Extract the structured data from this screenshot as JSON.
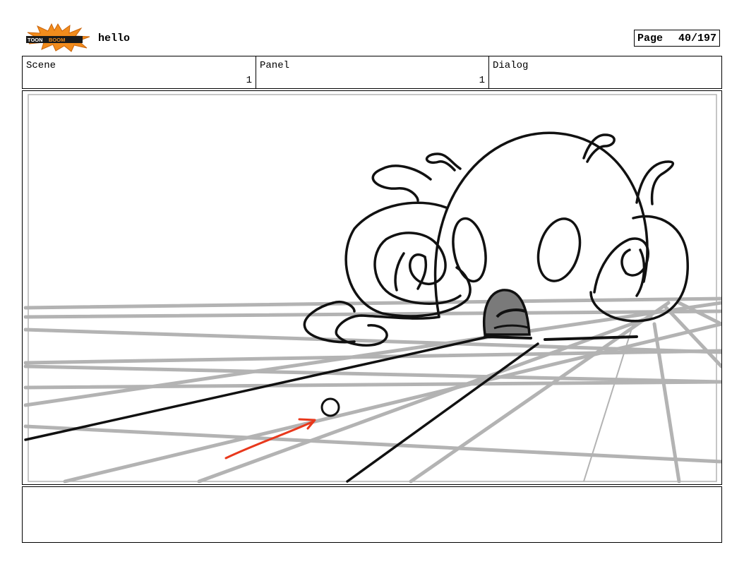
{
  "header": {
    "logo_text_left": "TOON",
    "logo_text_right": "BOOM",
    "project_title": "hello",
    "page_label": "Page",
    "page_number": "40/197"
  },
  "info": {
    "scene_label": "Scene",
    "scene_value": "1",
    "panel_label": "Panel",
    "panel_value": "1",
    "dialog_label": "Dialog",
    "dialog_value": ""
  },
  "notes": {
    "text": ""
  },
  "colors": {
    "grid": "#b3b3b3",
    "ink": "#111111",
    "arrow": "#e8381c",
    "shadow": "#7a7a7a",
    "logo_burst": "#f28c1c",
    "logo_band": "#1a1a1a"
  }
}
